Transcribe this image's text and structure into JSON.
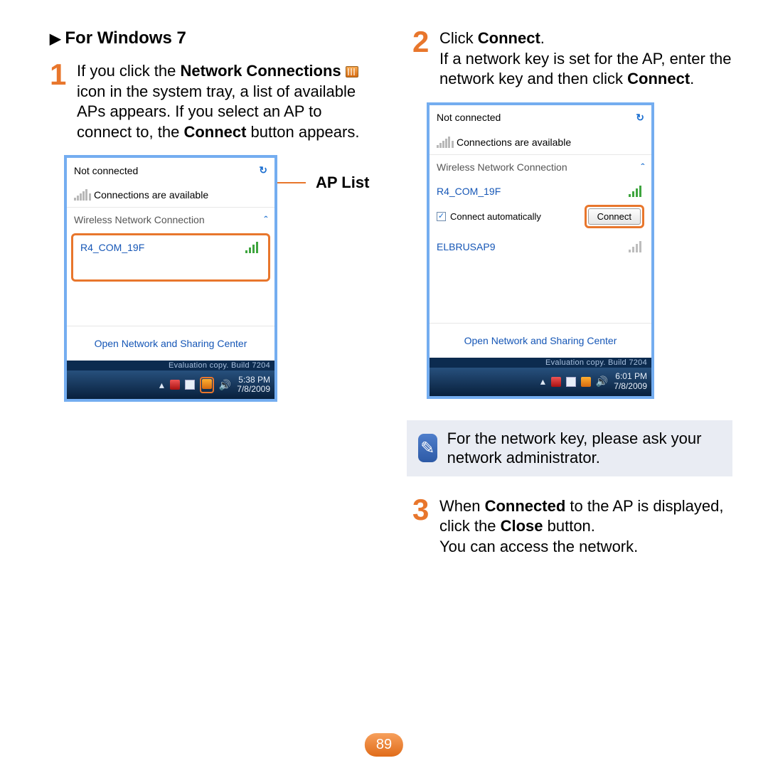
{
  "heading": "For Windows 7",
  "step1": {
    "parts": [
      "If you click the ",
      "Network Connections",
      " icon in the system tray, a list of available APs appears. If you select an AP to connect to, the ",
      "Connect",
      " button appears."
    ]
  },
  "apListLabel": "AP List",
  "step2": {
    "parts": [
      "Click ",
      "Connect",
      ".",
      "If a network key is set for the AP, enter the network key and then click ",
      "Connect",
      "."
    ]
  },
  "note": "For the network key, please ask your network administrator.",
  "step3": {
    "parts": [
      "When ",
      "Connected",
      " to the AP is displayed, click the ",
      "Close",
      " button.",
      "You can access the network."
    ]
  },
  "pageNumber": "89",
  "panel": {
    "notConnected": "Not connected",
    "connAvail": "Connections are available",
    "section": "Wireless Network Connection",
    "ap1": "R4_COM_19F",
    "ap2": "ELBRUSAP9",
    "autoConnect": "Connect automatically",
    "connectBtn": "Connect",
    "openCenter": "Open Network and Sharing Center",
    "evalStrip1": "Evaluation copy. Build 7204",
    "evalStrip2": "Evaluation copy. Build 7204",
    "time1": "5:38 PM",
    "date1": "7/8/2009",
    "time2": "6:01 PM",
    "date2": "7/8/2009"
  }
}
